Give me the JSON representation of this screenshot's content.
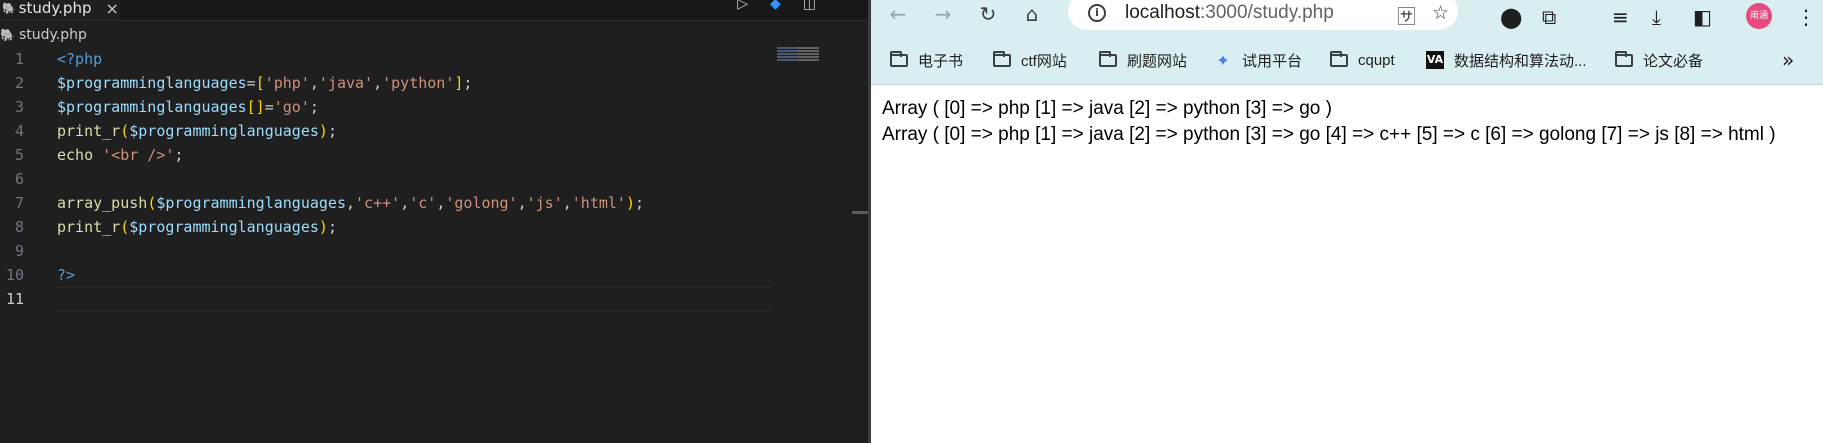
{
  "editor": {
    "tab": {
      "label": "study.php",
      "close_icon": "×"
    },
    "breadcrumb": "study.php",
    "lines": [
      {
        "num": "1",
        "tokens": [
          {
            "t": "<?php",
            "c": "kw"
          }
        ]
      },
      {
        "num": "2",
        "tokens": [
          {
            "t": "$programminglanguages",
            "c": "var"
          },
          {
            "t": "=",
            "c": "pun"
          },
          {
            "t": "[",
            "c": "br1"
          },
          {
            "t": "'php'",
            "c": "str"
          },
          {
            "t": ",",
            "c": "pun"
          },
          {
            "t": "'java'",
            "c": "str"
          },
          {
            "t": ",",
            "c": "pun"
          },
          {
            "t": "'python'",
            "c": "str"
          },
          {
            "t": "]",
            "c": "br1"
          },
          {
            "t": ";",
            "c": "pun"
          }
        ]
      },
      {
        "num": "3",
        "tokens": [
          {
            "t": "$programminglanguages",
            "c": "var"
          },
          {
            "t": "[]",
            "c": "br1"
          },
          {
            "t": "=",
            "c": "pun"
          },
          {
            "t": "'go'",
            "c": "str"
          },
          {
            "t": ";",
            "c": "pun"
          }
        ]
      },
      {
        "num": "4",
        "tokens": [
          {
            "t": "print_r",
            "c": "fn"
          },
          {
            "t": "(",
            "c": "br1"
          },
          {
            "t": "$programminglanguages",
            "c": "var"
          },
          {
            "t": ")",
            "c": "br1"
          },
          {
            "t": ";",
            "c": "pun"
          }
        ]
      },
      {
        "num": "5",
        "tokens": [
          {
            "t": "echo ",
            "c": "fn"
          },
          {
            "t": "'<br />'",
            "c": "str"
          },
          {
            "t": ";",
            "c": "pun"
          }
        ]
      },
      {
        "num": "6",
        "tokens": []
      },
      {
        "num": "7",
        "tokens": [
          {
            "t": "array_push",
            "c": "fn"
          },
          {
            "t": "(",
            "c": "br1"
          },
          {
            "t": "$programminglanguages",
            "c": "var"
          },
          {
            "t": ",",
            "c": "pun"
          },
          {
            "t": "'c++'",
            "c": "str"
          },
          {
            "t": ",",
            "c": "pun"
          },
          {
            "t": "'c'",
            "c": "str"
          },
          {
            "t": ",",
            "c": "pun"
          },
          {
            "t": "'golong'",
            "c": "str"
          },
          {
            "t": ",",
            "c": "pun"
          },
          {
            "t": "'js'",
            "c": "str"
          },
          {
            "t": ",",
            "c": "pun"
          },
          {
            "t": "'html'",
            "c": "str"
          },
          {
            "t": ")",
            "c": "br1"
          },
          {
            "t": ";",
            "c": "pun"
          }
        ]
      },
      {
        "num": "8",
        "tokens": [
          {
            "t": "print_r",
            "c": "fn"
          },
          {
            "t": "(",
            "c": "br1"
          },
          {
            "t": "$programminglanguages",
            "c": "var"
          },
          {
            "t": ")",
            "c": "br1"
          },
          {
            "t": ";",
            "c": "pun"
          }
        ]
      },
      {
        "num": "9",
        "tokens": []
      },
      {
        "num": "10",
        "tokens": [
          {
            "t": "?>",
            "c": "kw"
          }
        ]
      },
      {
        "num": "11",
        "tokens": [],
        "current": true
      }
    ]
  },
  "browser": {
    "url_host": "localhost",
    "url_rest": ":3000/study.php",
    "bookmarks": [
      {
        "label": "电子书",
        "icon": "folder-icon"
      },
      {
        "label": "ctf网站",
        "icon": "folder-icon"
      },
      {
        "label": "刷题网站",
        "icon": "folder-icon"
      },
      {
        "label": "试用平台",
        "icon": "site-icon"
      },
      {
        "label": "cqupt",
        "icon": "folder-icon"
      },
      {
        "label": "数据结构和算法动...",
        "icon": "visualgo-icon"
      },
      {
        "label": "论文必备",
        "icon": "folder-icon"
      }
    ],
    "profile_label": "雨涵",
    "output_line1": "Array ( [0] => php [1] => java [2] => python [3] => go )",
    "output_line2": "Array ( [0] => php [1] => java [2] => python [3] => go [4] => c++ [5] => c [6] => golong [7] => js [8] => html )"
  }
}
